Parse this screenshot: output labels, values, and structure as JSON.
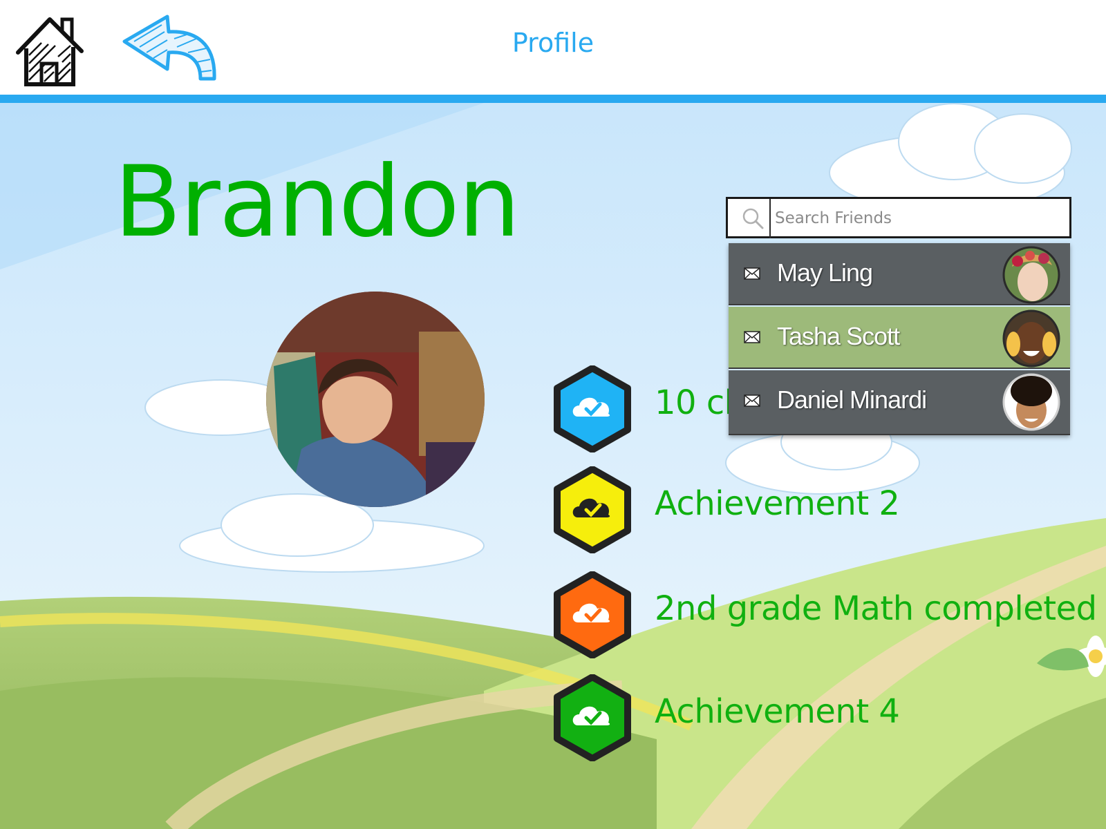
{
  "header": {
    "title": "Profile",
    "home_icon": "house-icon",
    "back_icon": "back-arrow-icon"
  },
  "profile": {
    "name": "Brandon",
    "avatar": "child-reading-photo"
  },
  "achievements": [
    {
      "label": "10 challenges completed",
      "color": "#1fb3f5",
      "icon": "cloud-check-icon"
    },
    {
      "label": "Achievement 2",
      "color": "#f6ee0c",
      "icon": "cloud-check-icon"
    },
    {
      "label": "2nd grade Math completed",
      "color": "#ff6a10",
      "icon": "cloud-check-icon"
    },
    {
      "label": "Achievement 4",
      "color": "#12b012",
      "icon": "cloud-check-icon"
    }
  ],
  "friends": {
    "search_placeholder": "Search Friends",
    "items": [
      {
        "name": "May Ling",
        "icon": "mail-icon",
        "avatar": "girl-with-flowers-photo",
        "highlighted": false
      },
      {
        "name": "Tasha Scott",
        "icon": "mail-icon",
        "avatar": "smiling-girl-photo",
        "highlighted": true
      },
      {
        "name": "Daniel Minardi",
        "icon": "mail-icon",
        "avatar": "curly-hair-boy-photo",
        "highlighted": false
      }
    ]
  },
  "colors": {
    "accent": "#29a9f0",
    "name_green": "#00b000",
    "row_dark": "#5a5f62",
    "row_highlight": "#9dba7a"
  }
}
